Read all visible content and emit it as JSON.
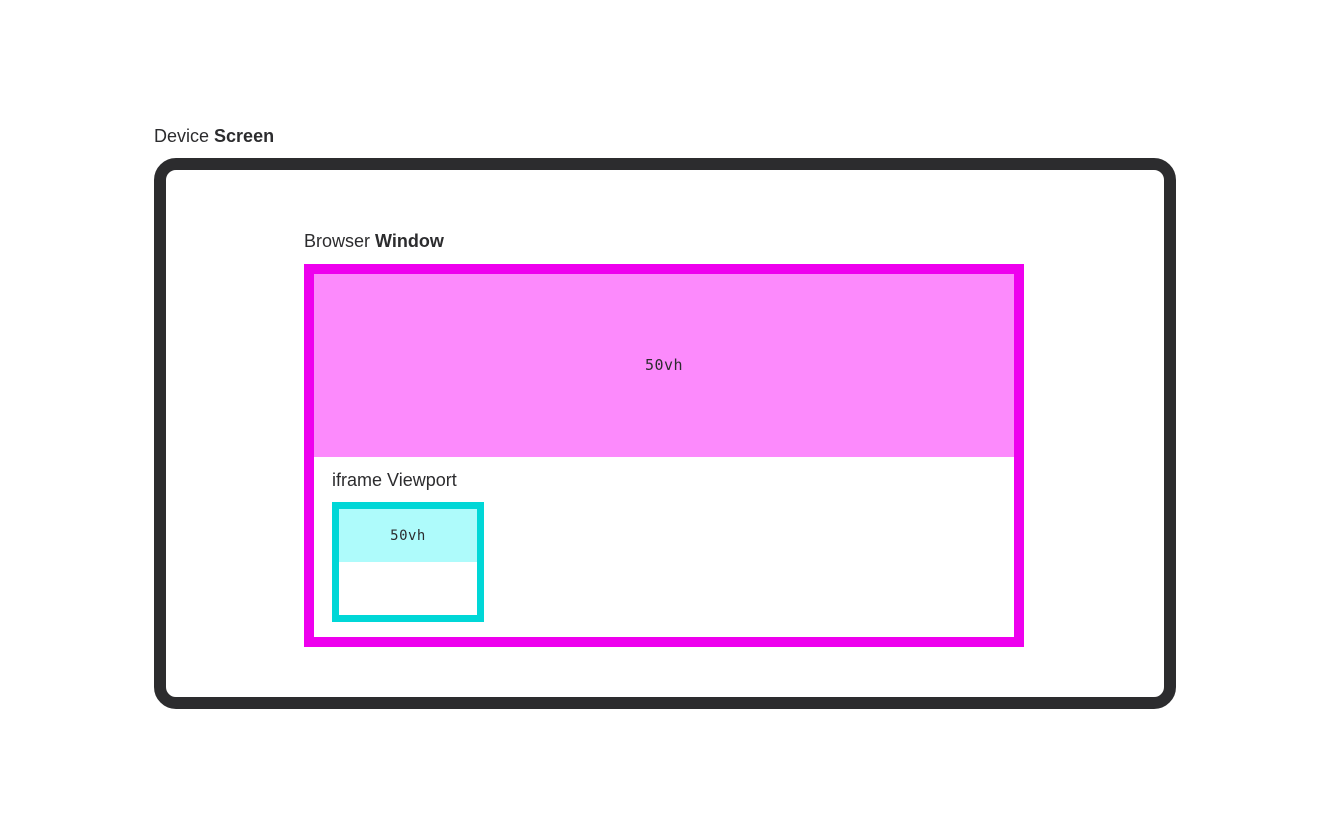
{
  "device": {
    "label_prefix": "Device ",
    "label_bold": "Screen"
  },
  "browser": {
    "label_prefix": "Browser ",
    "label_bold": "Window",
    "vh_label": "50vh"
  },
  "iframe": {
    "label_prefix": "iframe ",
    "label_bold": "Viewport",
    "vh_label": "50vh"
  },
  "colors": {
    "screen_border": "#2c2c2e",
    "browser_border": "#ee00ee",
    "browser_fill": "#fc8afc",
    "iframe_border": "#00d7d7",
    "iframe_fill": "#aefbfb"
  }
}
